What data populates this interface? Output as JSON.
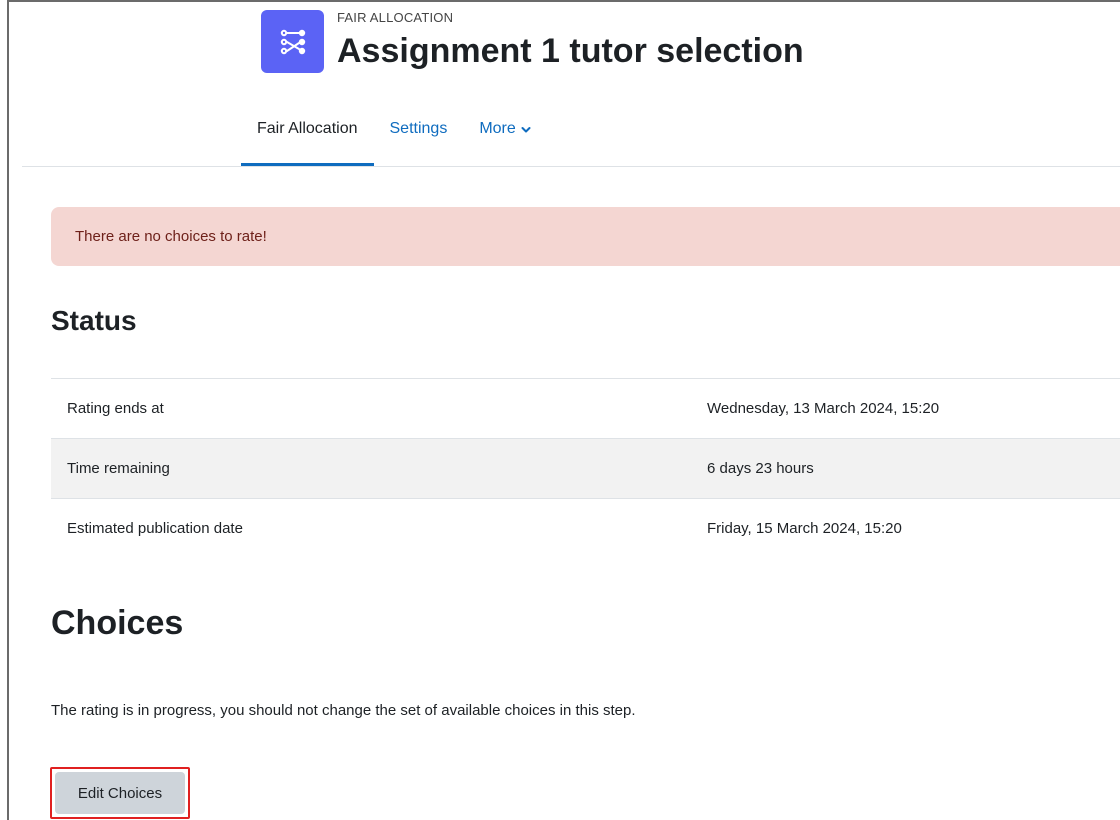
{
  "header": {
    "activity_type": "FAIR ALLOCATION",
    "title": "Assignment 1 tutor selection",
    "icon": "allocation-icon",
    "icon_color": "#5b63f5"
  },
  "nav": {
    "tabs": [
      {
        "label": "Fair Allocation",
        "active": true
      },
      {
        "label": "Settings",
        "active": false
      },
      {
        "label": "More",
        "active": false,
        "icon": "chevron-down-icon"
      }
    ]
  },
  "alert": {
    "text": "There are no choices to rate!",
    "background": "#f4d6d2"
  },
  "status": {
    "heading": "Status",
    "rows": [
      {
        "label": "Rating ends at",
        "value": "Wednesday, 13 March 2024, 15:20"
      },
      {
        "label": "Time remaining",
        "value": "6 days 23 hours"
      },
      {
        "label": "Estimated publication date",
        "value": "Friday, 15 March 2024, 15:20"
      }
    ]
  },
  "choices": {
    "heading": "Choices",
    "description": "The rating is in progress, you should not change the set of available choices in this step.",
    "edit_button": "Edit Choices"
  },
  "colors": {
    "link": "#0f6cbf",
    "highlight_border": "#e02020"
  }
}
